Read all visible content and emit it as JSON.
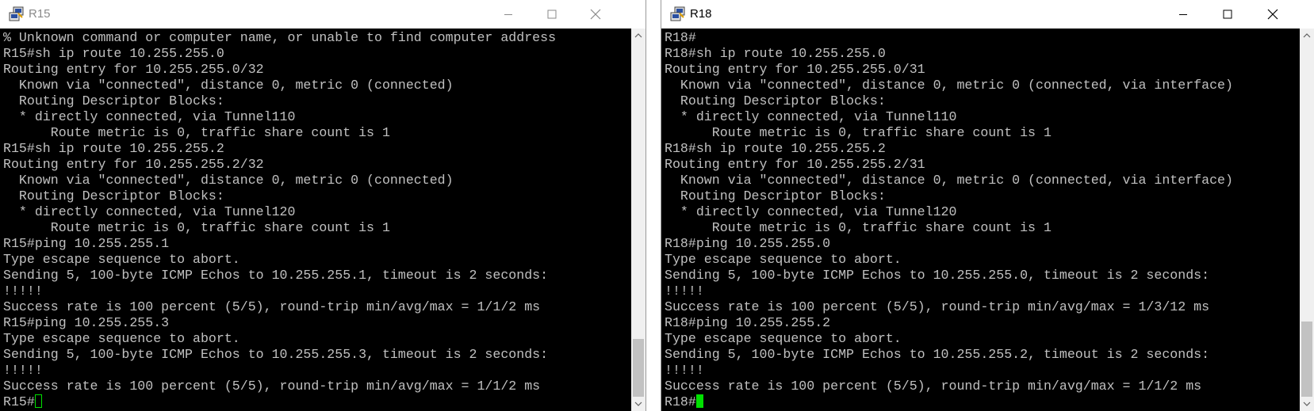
{
  "windows": {
    "r15": {
      "title": "R15",
      "lines": [
        "% Unknown command or computer name, or unable to find computer address",
        "R15#sh ip route 10.255.255.0",
        "Routing entry for 10.255.255.0/32",
        "  Known via \"connected\", distance 0, metric 0 (connected)",
        "  Routing Descriptor Blocks:",
        "  * directly connected, via Tunnel110",
        "      Route metric is 0, traffic share count is 1",
        "R15#sh ip route 10.255.255.2",
        "Routing entry for 10.255.255.2/32",
        "  Known via \"connected\", distance 0, metric 0 (connected)",
        "  Routing Descriptor Blocks:",
        "  * directly connected, via Tunnel120",
        "      Route metric is 0, traffic share count is 1",
        "R15#ping 10.255.255.1",
        "Type escape sequence to abort.",
        "Sending 5, 100-byte ICMP Echos to 10.255.255.1, timeout is 2 seconds:",
        "!!!!!",
        "Success rate is 100 percent (5/5), round-trip min/avg/max = 1/1/2 ms",
        "R15#ping 10.255.255.3",
        "Type escape sequence to abort.",
        "Sending 5, 100-byte ICMP Echos to 10.255.255.3, timeout is 2 seconds:",
        "!!!!!",
        "Success rate is 100 percent (5/5), round-trip min/avg/max = 1/1/2 ms"
      ],
      "prompt": "R15#"
    },
    "r18": {
      "title": "R18",
      "lines": [
        "R18#",
        "R18#sh ip route 10.255.255.0",
        "Routing entry for 10.255.255.0/31",
        "  Known via \"connected\", distance 0, metric 0 (connected, via interface)",
        "  Routing Descriptor Blocks:",
        "  * directly connected, via Tunnel110",
        "      Route metric is 0, traffic share count is 1",
        "R18#sh ip route 10.255.255.2",
        "Routing entry for 10.255.255.2/31",
        "  Known via \"connected\", distance 0, metric 0 (connected, via interface)",
        "  Routing Descriptor Blocks:",
        "  * directly connected, via Tunnel120",
        "      Route metric is 0, traffic share count is 1",
        "R18#ping 10.255.255.0",
        "Type escape sequence to abort.",
        "Sending 5, 100-byte ICMP Echos to 10.255.255.0, timeout is 2 seconds:",
        "!!!!!",
        "Success rate is 100 percent (5/5), round-trip min/avg/max = 1/3/12 ms",
        "R18#ping 10.255.255.2",
        "Type escape sequence to abort.",
        "Sending 5, 100-byte ICMP Echos to 10.255.255.2, timeout is 2 seconds:",
        "!!!!!",
        "Success rate is 100 percent (5/5), round-trip min/avg/max = 1/1/2 ms"
      ],
      "prompt": "R18#"
    }
  },
  "icons": {
    "app": "putty-icon",
    "minimize": "minimize-icon",
    "maximize": "maximize-icon",
    "close": "close-icon",
    "scroll_up": "chevron-up-icon",
    "scroll_down": "chevron-down-icon"
  },
  "colors": {
    "terminal_bg": "#000000",
    "terminal_text": "#c0c0c0",
    "cursor": "#00e000",
    "inactive_title": "#8a8a8a",
    "active_title": "#000000"
  }
}
